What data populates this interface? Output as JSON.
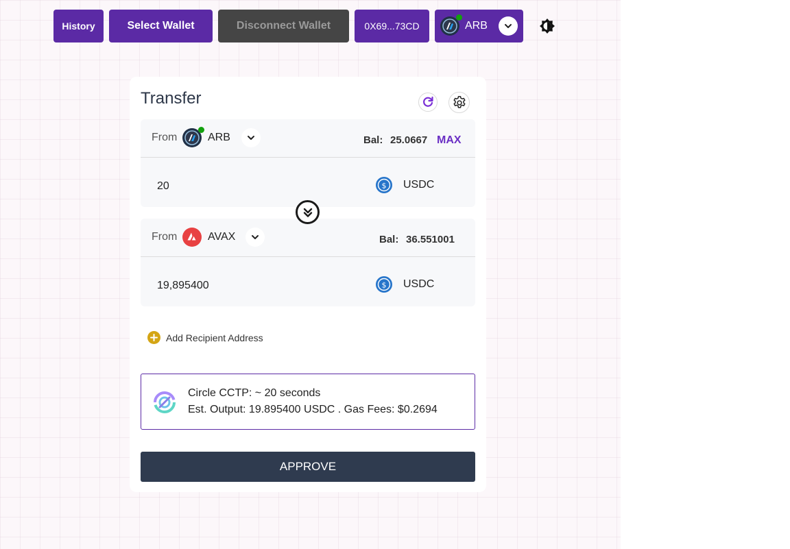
{
  "topbar": {
    "history_label": "History",
    "select_wallet_label": "Select Wallet",
    "disconnect_wallet_label": "Disconnect Wallet",
    "address_label": "0X69...73CD",
    "network_label": "ARB",
    "network_icon": "arbitrum-icon",
    "theme_icon": "brightness-icon"
  },
  "transfer": {
    "title": "Transfer",
    "from": {
      "label": "From",
      "chain": "ARB",
      "chain_icon": "arbitrum-icon",
      "balance_label": "Bal:",
      "balance_value": "25.0667",
      "max_label": "MAX",
      "amount": "20",
      "token": "USDC",
      "token_icon": "usdc-icon"
    },
    "to": {
      "label": "From",
      "chain": "AVAX",
      "chain_icon": "avalanche-icon",
      "balance_label": "Bal:",
      "balance_value": "36.551001",
      "amount": "19,895400",
      "token": "USDC",
      "token_icon": "usdc-icon"
    },
    "add_recipient_label": "Add Recipient Address",
    "route": {
      "line1": "Circle CCTP: ~ 20 seconds",
      "line2": "Est. Output: 19.895400 USDC . Gas Fees: $0.2694"
    },
    "approve_label": "APPROVE"
  },
  "colors": {
    "primary": "#5b2aa5",
    "disabled": "#454545",
    "approve": "#2f3b4f",
    "max": "#6a2fc4",
    "online": "#13a10e",
    "plus": "#d4a514"
  }
}
